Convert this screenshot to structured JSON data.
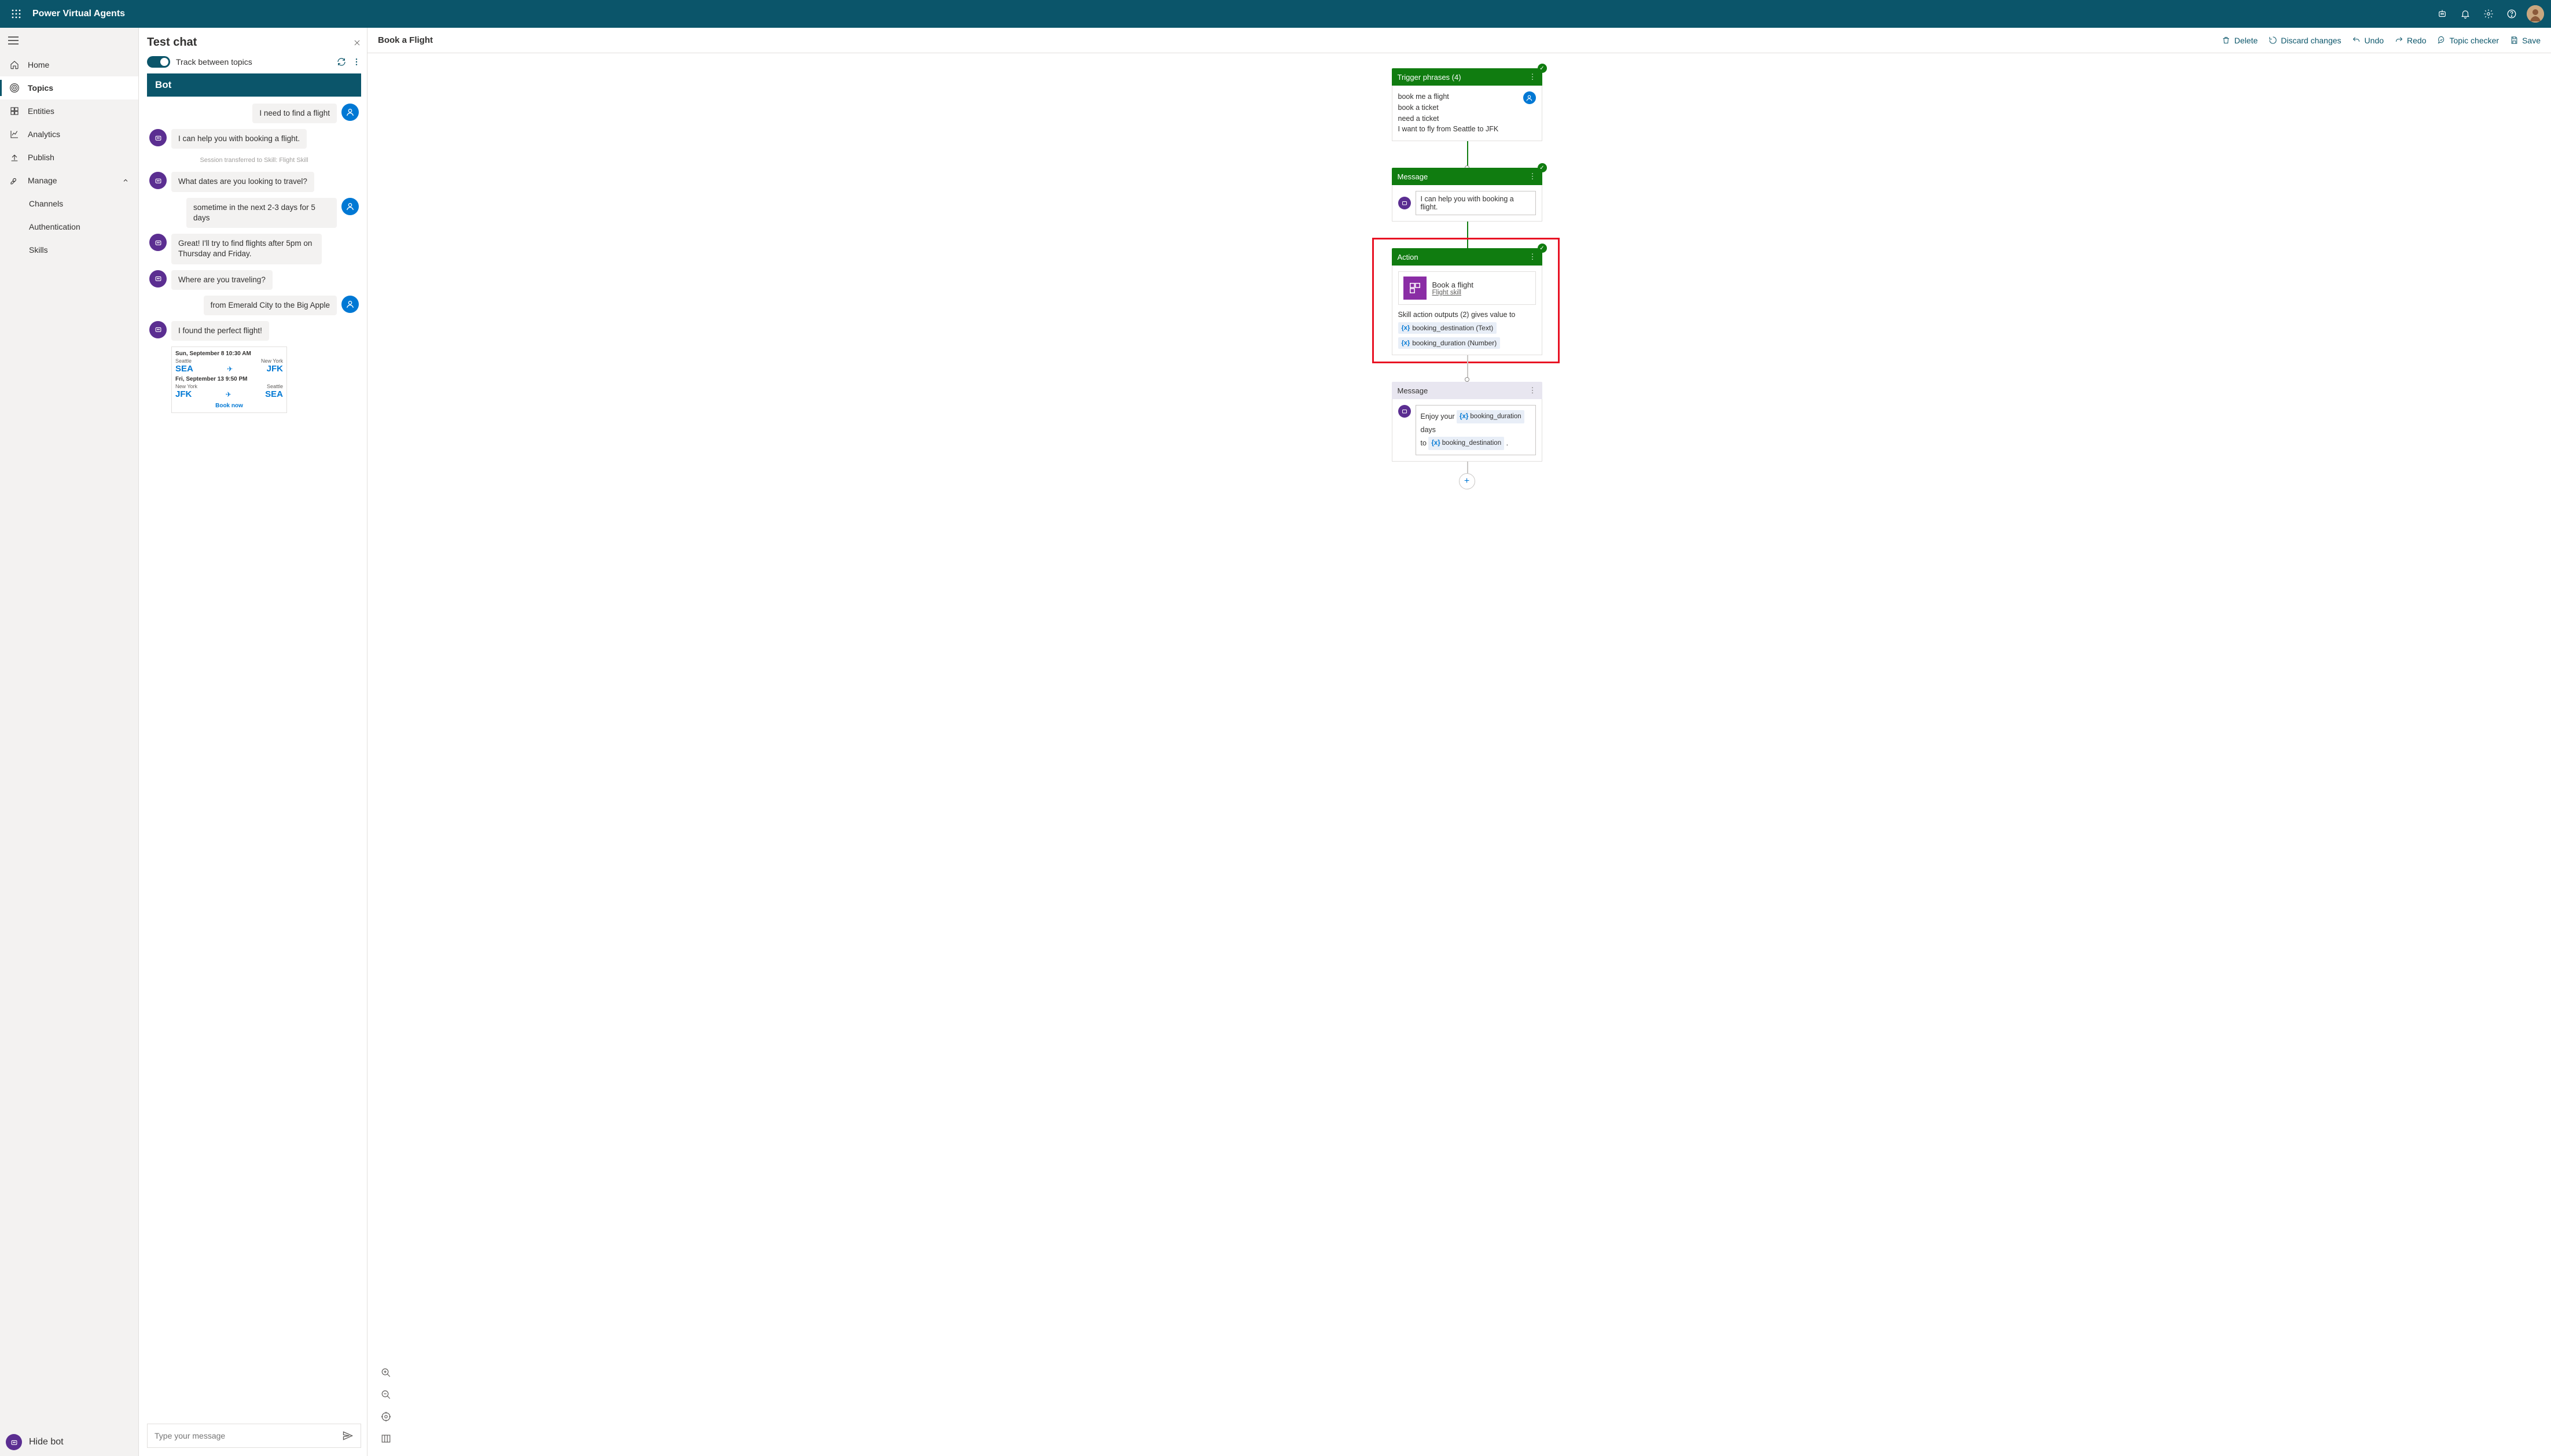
{
  "topbar": {
    "title": "Power Virtual Agents"
  },
  "sidebar": {
    "items": [
      {
        "label": "Home"
      },
      {
        "label": "Topics"
      },
      {
        "label": "Entities"
      },
      {
        "label": "Analytics"
      },
      {
        "label": "Publish"
      },
      {
        "label": "Manage"
      }
    ],
    "sub": [
      {
        "label": "Channels"
      },
      {
        "label": "Authentication"
      },
      {
        "label": "Skills"
      }
    ],
    "hide_bot": "Hide bot"
  },
  "testchat": {
    "title": "Test chat",
    "track_label": "Track between topics",
    "bot_title": "Bot",
    "messages": {
      "u1": "I need to find a flight",
      "b1": "I can help you with booking a flight.",
      "session": "Session transferred to Skill: Flight Skill",
      "b2": "What dates are you looking to travel?",
      "u2": "sometime in the next 2-3 days for 5 days",
      "b3": "Great! I'll try to find flights after 5pm on Thursday and Friday.",
      "b4": "Where are you traveling?",
      "u3": "from Emerald City to the Big Apple",
      "b5": "I found the perfect flight!"
    },
    "card": {
      "d1": "Sun, September 8 10:30 AM",
      "c1a": "Seattle",
      "c1b": "New York",
      "code1a": "SEA",
      "code1b": "JFK",
      "d2": "Fri, September 13 9:50 PM",
      "c2a": "New York",
      "c2b": "Seattle",
      "code2a": "JFK",
      "code2b": "SEA",
      "book": "Book now"
    },
    "placeholder": "Type your message"
  },
  "canvas": {
    "title": "Book a Flight",
    "toolbar": {
      "delete": "Delete",
      "discard": "Discard changes",
      "undo": "Undo",
      "redo": "Redo",
      "checker": "Topic checker",
      "save": "Save"
    },
    "trigger": {
      "header": "Trigger phrases (4)",
      "phrases": [
        "book me a flight",
        "book a ticket",
        "need a ticket",
        "I want to fly from Seattle to JFK"
      ]
    },
    "message1": {
      "header": "Message",
      "text": "I can help you with booking a flight."
    },
    "action": {
      "header": "Action",
      "skill_name": "Book a flight",
      "skill_link": "Flight skill",
      "outputs_label": "Skill action outputs (2) gives value to",
      "out1": "booking_destination (Text)",
      "out2": "booking_duration (Number)"
    },
    "message2": {
      "header": "Message",
      "t1": "Enjoy your",
      "v1": "booking_duration",
      "t2": "days",
      "t3": "to",
      "v2": "booking_destination",
      "t4": "."
    }
  }
}
